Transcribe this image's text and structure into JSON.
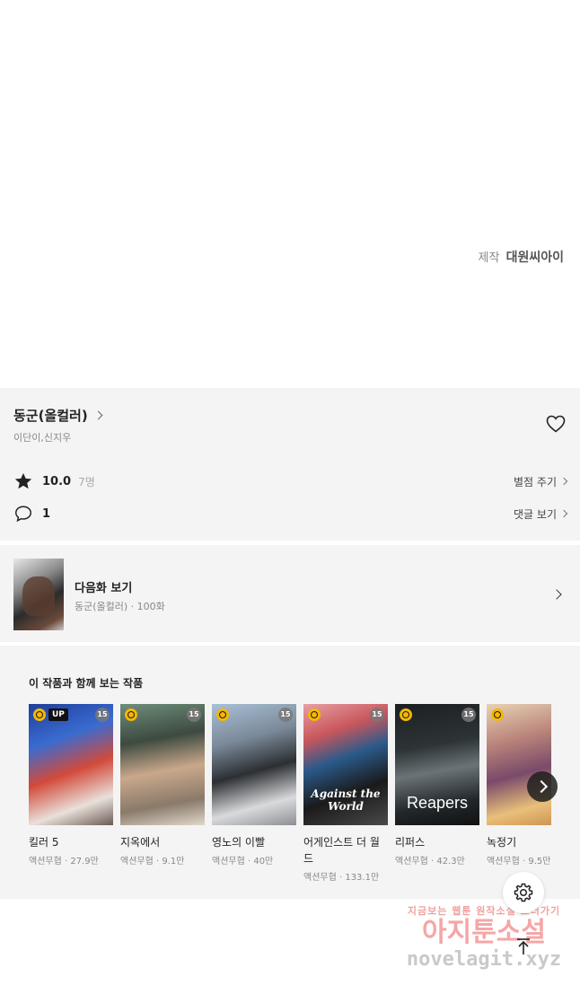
{
  "credit": {
    "label": "제작",
    "studio": "대원씨아이"
  },
  "series": {
    "title": "동군(올컬러)",
    "authors": "이단이,신지우",
    "rating": "10.0",
    "rating_count": "7명",
    "rate_action": "별점 주기",
    "comment_count": "1",
    "comment_action": "댓글 보기"
  },
  "next_episode": {
    "label": "다음화 보기",
    "sub": "동군(올컬러) · 100화"
  },
  "recommendations": {
    "heading": "이 작품과 함께 보는 작품",
    "items": [
      {
        "title": "킬러 5",
        "meta": "액션무협 · 27.9만",
        "up": "UP",
        "age": "15",
        "cover": "#3a6bd0",
        "cover_text": ""
      },
      {
        "title": "지옥에서",
        "meta": "액션무협 · 9.1만",
        "up": "",
        "age": "15",
        "cover": "#3d4a40",
        "cover_text": ""
      },
      {
        "title": "영노의 이빨",
        "meta": "액션무협 · 40만",
        "up": "",
        "age": "15",
        "cover": "#7b8a99",
        "cover_text": ""
      },
      {
        "title": "어게인스트 더 월드",
        "meta": "액션무협 · 133.1만",
        "up": "",
        "age": "15",
        "cover": "#c8575d",
        "cover_text": "Against the World"
      },
      {
        "title": "리퍼스",
        "meta": "액션무협 · 42.3만",
        "up": "",
        "age": "15",
        "cover": "#2d3436",
        "cover_text": "Reapers"
      },
      {
        "title": "녹정기",
        "meta": "액션무협 · 9.5만",
        "up": "",
        "age": "",
        "cover": "#b9837a",
        "cover_text": ""
      }
    ]
  },
  "watermark": {
    "line1": "지금보는 웹툰 원작소설 보러가기",
    "line2": "아지툰소설",
    "line3": "novelagit.xyz"
  }
}
